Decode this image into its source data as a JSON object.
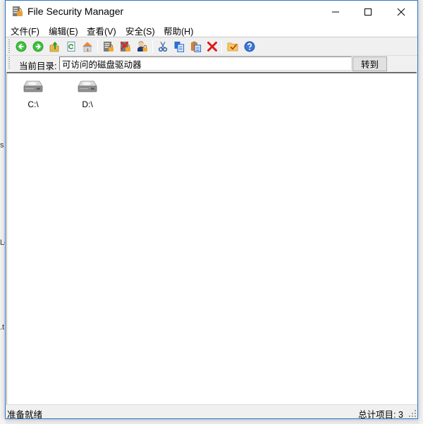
{
  "window": {
    "title": "File Security Manager",
    "controls": {
      "minimize": "minimize",
      "maximize": "maximize",
      "close": "close"
    }
  },
  "menu": [
    {
      "label": "文件(F)"
    },
    {
      "label": "编辑(E)"
    },
    {
      "label": "查看(V)"
    },
    {
      "label": "安全(S)"
    },
    {
      "label": "帮助(H)"
    }
  ],
  "toolbar": {
    "buttons": [
      {
        "name": "back",
        "icon": "back-arrow-icon"
      },
      {
        "name": "forward",
        "icon": "forward-arrow-icon"
      },
      {
        "name": "up-folder",
        "icon": "up-folder-icon"
      },
      {
        "name": "refresh",
        "icon": "refresh-icon"
      },
      {
        "name": "home",
        "icon": "home-icon"
      },
      {
        "name": "lock-list",
        "icon": "lock-list-icon"
      },
      {
        "name": "unlock",
        "icon": "unlock-icon"
      },
      {
        "name": "user-lock",
        "icon": "user-lock-icon"
      },
      {
        "name": "cut",
        "icon": "scissors-icon"
      },
      {
        "name": "copy",
        "icon": "copy-icon"
      },
      {
        "name": "paste",
        "icon": "paste-icon"
      },
      {
        "name": "delete",
        "icon": "delete-x-icon"
      },
      {
        "name": "folder-options",
        "icon": "folder-check-icon"
      },
      {
        "name": "help",
        "icon": "help-icon"
      }
    ]
  },
  "address": {
    "label": "当前目录:",
    "value": "可访问的磁盘驱动器",
    "goto_label": "转到"
  },
  "drives": [
    {
      "label": "C:\\"
    },
    {
      "label": "D:\\"
    }
  ],
  "status": {
    "left": "准备就绪",
    "right": "总计项目: 3"
  },
  "background_fragments": [
    "s",
    "Lo",
    ".t"
  ]
}
